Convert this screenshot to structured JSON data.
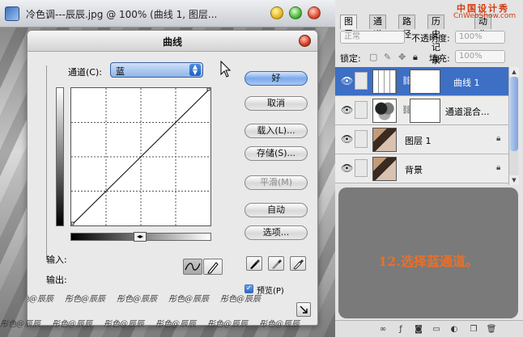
{
  "document": {
    "title": "冷色调---辰辰.jpg @ 100% (曲线 1, 图层..."
  },
  "curves_dialog": {
    "title": "曲线",
    "channel_label": "通道(C):",
    "channel_value": "蓝",
    "buttons": {
      "ok": "好",
      "cancel": "取消",
      "load": "载入(L)...",
      "save": "存储(S)...",
      "smooth": "平滑(M)",
      "auto": "自动",
      "options": "选项..."
    },
    "input_label": "输入:",
    "output_label": "输出:",
    "preview_label": "预览(P)",
    "preview_checked": true,
    "watermark": "彤色@辰辰"
  },
  "layers_panel": {
    "tabs": [
      "图层",
      "通道",
      "路径",
      "历史记录",
      "动作"
    ],
    "blend_mode": "正常",
    "opacity_label": "不透明度:",
    "opacity_value": "100%",
    "lock_label": "锁定:",
    "fill_label": "填充:",
    "fill_value": "100%",
    "layers": [
      {
        "name": "曲线 1",
        "selected": true
      },
      {
        "name": "通道混合...",
        "selected": false
      },
      {
        "name": "图层 1",
        "selected": false
      },
      {
        "name": "背景",
        "selected": false
      }
    ],
    "instruction": "12.选择蓝通道。"
  },
  "site_watermark": {
    "cn": "中国设计秀",
    "url": "CnWebShow.com"
  },
  "colors": {
    "selected_layer": "#3d6fc4",
    "instruction_text": "#e8702a",
    "instruction_bg": "#7a7a7a"
  }
}
